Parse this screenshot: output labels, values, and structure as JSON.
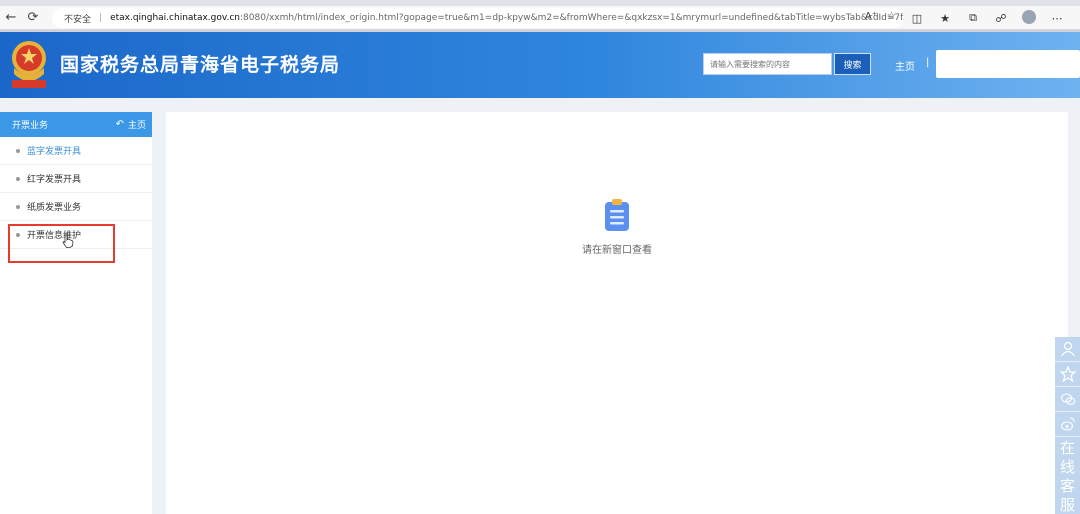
{
  "browser": {
    "insecure_label": "不安全",
    "separator": "|",
    "url_host": "etax.qinghai.chinatax.gov.cn",
    "url_rest": ":8080/xxmh/html/index_origin.html?gopage=true&m1=dp-kpyw&m2=&fromWhere=&qxkzsx=1&mrymurl=undefined&tabTitle=wybsTab&cdId=7f..."
  },
  "header": {
    "title": "国家税务总局青海省电子税务局",
    "search_placeholder": "请输入需要搜索的内容",
    "search_button": "搜索",
    "home_link": "主页",
    "home_sep": "|"
  },
  "sidebar": {
    "header_title": "开票业务",
    "home_label": "主页",
    "items": [
      {
        "label": "蓝字发票开具"
      },
      {
        "label": "红字发票开具"
      },
      {
        "label": "纸质发票业务"
      },
      {
        "label": "开票信息维护"
      }
    ]
  },
  "main": {
    "empty_text": "请在新窗口查看"
  },
  "float_bar": {
    "customer_service": [
      "在",
      "线",
      "客",
      "服"
    ]
  },
  "colors": {
    "header_blue": "#1b67c9",
    "sidebar_blue": "#3a98e6",
    "active_link": "#3a8fd8",
    "highlight_red": "#e53a2c"
  }
}
